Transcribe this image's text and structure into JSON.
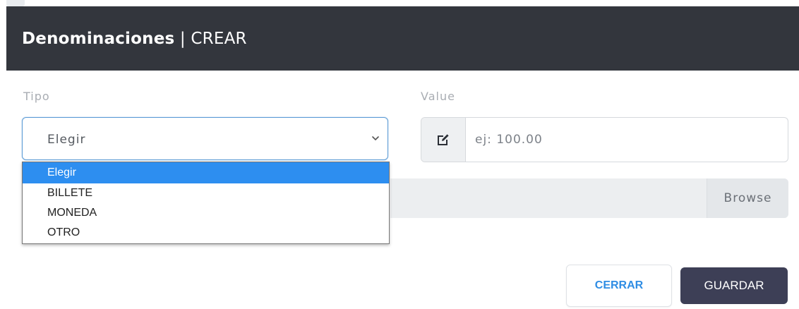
{
  "header": {
    "entity": "Denominaciones",
    "separator": " | ",
    "action": "CREAR"
  },
  "form": {
    "tipo": {
      "label": "Tipo",
      "selected": "Elegir",
      "options": [
        "Elegir",
        "BILLETE",
        "MONEDA",
        "OTRO"
      ]
    },
    "value": {
      "label": "Value",
      "placeholder": "ej: 100.00",
      "icon": "edit-icon"
    },
    "file": {
      "browse_label": "Browse"
    }
  },
  "footer": {
    "close_label": "CERRAR",
    "save_label": "GUARDAR"
  },
  "colors": {
    "header_bg": "#33363d",
    "focus_border": "#5b9bd5",
    "option_highlight": "#2d8ef0",
    "close_text": "#2f8de4",
    "save_bg": "#3d3f56"
  }
}
